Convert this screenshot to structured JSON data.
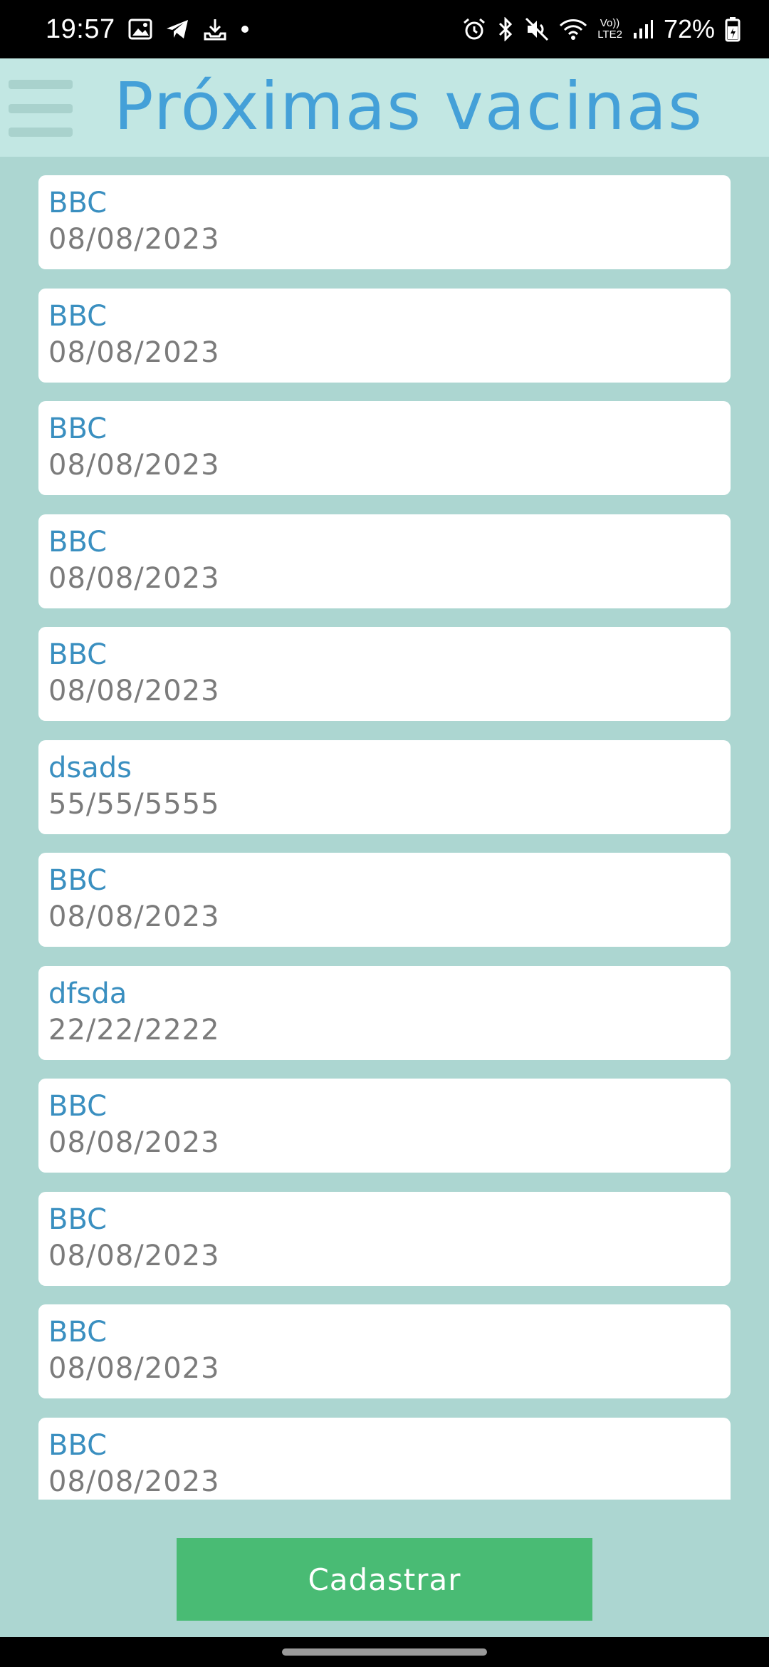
{
  "status_bar": {
    "time": "19:57",
    "battery": "72%",
    "network_label_top": "Vo))",
    "network_label_bottom": "LTE2",
    "left_icons": [
      "image-icon",
      "telegram-icon",
      "download-icon",
      "dot-icon"
    ],
    "right_icons": [
      "alarm-icon",
      "bluetooth-icon",
      "mute-icon",
      "wifi-icon",
      "signal-icon",
      "battery-icon"
    ]
  },
  "header": {
    "title": "Próximas vacinas",
    "menu_icon": "hamburger-menu-icon"
  },
  "vaccines": [
    {
      "name": "BBC",
      "date": "08/08/2023"
    },
    {
      "name": "BBC",
      "date": "08/08/2023"
    },
    {
      "name": "BBC",
      "date": "08/08/2023"
    },
    {
      "name": "BBC",
      "date": "08/08/2023"
    },
    {
      "name": "BBC",
      "date": "08/08/2023"
    },
    {
      "name": "dsads",
      "date": "55/55/5555"
    },
    {
      "name": "BBC",
      "date": "08/08/2023"
    },
    {
      "name": "dfsda",
      "date": "22/22/2222"
    },
    {
      "name": "BBC",
      "date": "08/08/2023"
    },
    {
      "name": "BBC",
      "date": "08/08/2023"
    },
    {
      "name": "BBC",
      "date": "08/08/2023"
    },
    {
      "name": "BBC",
      "date": "08/08/2023"
    }
  ],
  "footer": {
    "register_label": "Cadastrar"
  },
  "colors": {
    "background": "#acd6d1",
    "app_bar": "#c2e7e3",
    "title": "#44a0d8",
    "item_name": "#3a8fc0",
    "item_date": "#7b7b7b",
    "button": "#49bb74"
  }
}
